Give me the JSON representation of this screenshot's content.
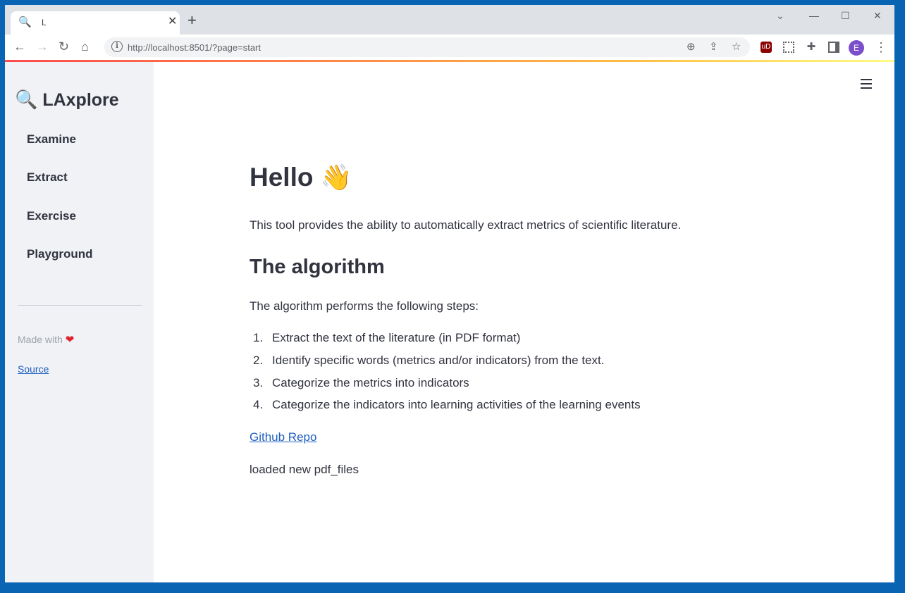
{
  "browser": {
    "tab_title": "L",
    "url": "http://localhost:8501/?page=start",
    "avatar_letter": "E",
    "ublock_label": "uD"
  },
  "sidebar": {
    "brand": "LAxplore",
    "items": [
      {
        "label": "Examine"
      },
      {
        "label": "Extract"
      },
      {
        "label": "Exercise"
      },
      {
        "label": "Playground"
      }
    ],
    "made_with": "Made with",
    "source_label": "Source"
  },
  "main": {
    "title": "Hello",
    "intro": "This tool provides the ability to automatically extract metrics of scientific literature.",
    "section_title": "The algorithm",
    "steps_intro": "The algorithm performs the following steps:",
    "steps": [
      {
        "num": "1.",
        "text": "Extract the text of the literature (in PDF format)"
      },
      {
        "num": "2.",
        "text": "Identify specific words (metrics and/or indicators) from the text."
      },
      {
        "num": "3.",
        "text": "Categorize the metrics into indicators"
      },
      {
        "num": "4.",
        "text": "Categorize the indicators into learning activities of the learning events"
      }
    ],
    "github_label": "Github Repo",
    "status": "loaded new pdf_files"
  },
  "colors": {
    "accent": "#ff4b4b",
    "sidebar_bg": "#f0f2f6",
    "link": "#1f5fbf",
    "text": "#31333f"
  }
}
